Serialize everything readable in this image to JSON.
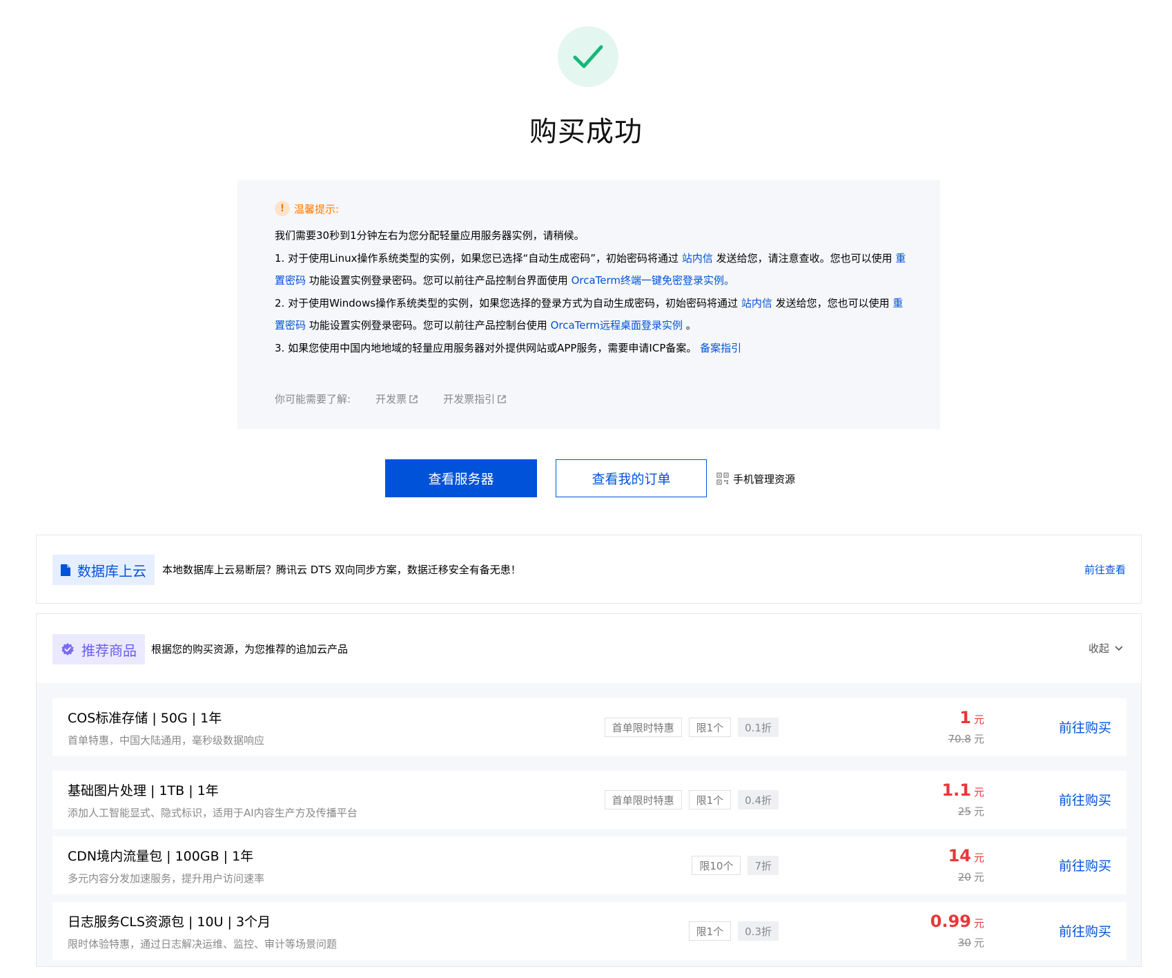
{
  "header": {
    "title": "购买成功"
  },
  "notice": {
    "title": "温馨提示:",
    "line0": "我们需要30秒到1分钟左右为您分配轻量应用服务器实例，请稍候。",
    "l1a": "1. 对于使用Linux操作系统类型的实例，如果您已选择“自动生成密码”，初始密码将通过 ",
    "l1_link1": "站内信",
    "l1b": " 发送给您，请注意查收。您也可以使用 ",
    "l1_link2": "重置密码",
    "l1c": " 功能设置实例登录密码。您可以前往产品控制台界面使用 ",
    "l1_link3": "OrcaTerm终端一键免密登录实例。",
    "l2a": "2. 对于使用Windows操作系统类型的实例，如果您选择的登录方式为自动生成密码，初始密码将通过 ",
    "l2_link1": "站内信",
    "l2b": " 发送给您，您也可以使用 ",
    "l2_link2": "重置密码",
    "l2c": " 功能设置实例登录密码。您可以前往产品控制台使用 ",
    "l2_link3": "OrcaTerm远程桌面登录实例",
    "l2d": " 。",
    "l3a": "3. 如果您使用中国内地地域的轻量应用服务器对外提供网站或APP服务，需要申请ICP备案。 ",
    "l3_link": "备案指引",
    "learn_label": "你可能需要了解:",
    "learn_links": [
      "开发票",
      "开发票指引"
    ]
  },
  "actions": {
    "primary": "查看服务器",
    "secondary": "查看我的订单",
    "mobile": "手机管理资源"
  },
  "db_banner": {
    "tag": "数据库上云",
    "desc": "本地数据库上云易断层？腾讯云 DTS 双向同步方案，数据迁移安全有备无患！",
    "link": "前往查看"
  },
  "recommend": {
    "tag": "推荐商品",
    "desc": "根据您的购买资源，为您推荐的追加云产品",
    "collapse": "收起",
    "products": [
      {
        "name": "COS标准存储 | 50G | 1年",
        "desc": "首单特惠，中国大陆通用，毫秒级数据响应",
        "chips": [
          "首单限时特惠",
          "限1个"
        ],
        "discount": "0.1折",
        "price": "1",
        "unit": "元",
        "orig": "70.8",
        "orig_unit": "元",
        "buy": "前往购买"
      },
      {
        "name": "基础图片处理 | 1TB | 1年",
        "desc": "添加人工智能显式、隐式标识，适用于AI内容生产方及传播平台",
        "chips": [
          "首单限时特惠",
          "限1个"
        ],
        "discount": "0.4折",
        "price": "1.1",
        "unit": "元",
        "orig": "25",
        "orig_unit": "元",
        "buy": "前往购买"
      },
      {
        "name": "CDN境内流量包 | 100GB | 1年",
        "desc": "多元内容分发加速服务，提升用户访问速率",
        "chips": [
          "限10个"
        ],
        "discount": "7折",
        "price": "14",
        "unit": "元",
        "orig": "20",
        "orig_unit": "元",
        "buy": "前往购买"
      },
      {
        "name": "日志服务CLS资源包 | 10U | 3个月",
        "desc": "限时体验特惠，通过日志解决运维、监控、审计等场景问题",
        "chips": [
          "限1个"
        ],
        "discount": "0.3折",
        "price": "0.99",
        "unit": "元",
        "orig": "30",
        "orig_unit": "元",
        "buy": "前往购买"
      }
    ]
  },
  "colors": {
    "brand": "#0052d9",
    "success": "#14b87a",
    "warning": "#ff7a00",
    "price": "#e63838"
  }
}
